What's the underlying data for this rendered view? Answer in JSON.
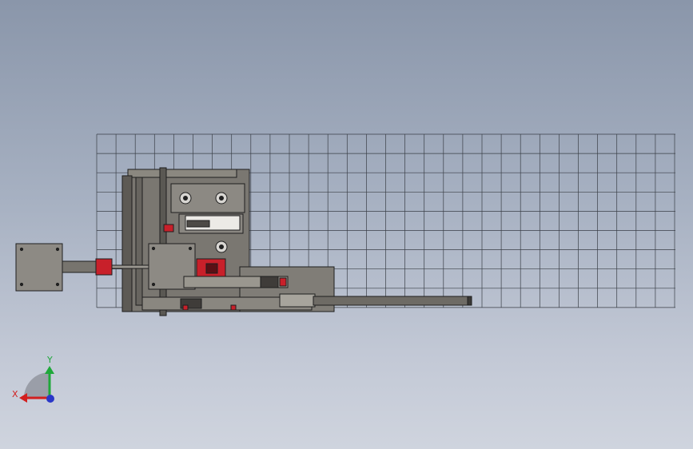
{
  "viewport": {
    "background_top": "#8a96aa",
    "background_bottom": "#cfd4de",
    "grid_color": "#3a3f47",
    "model_color": "#6b6862",
    "model_edge": "#1e1e1e",
    "accent_red": "#c8202a"
  },
  "triad": {
    "x_label": "X",
    "y_label": "Y",
    "x_color": "#d21f1f",
    "y_color": "#1fa83a",
    "z_color": "#2a37c8"
  }
}
